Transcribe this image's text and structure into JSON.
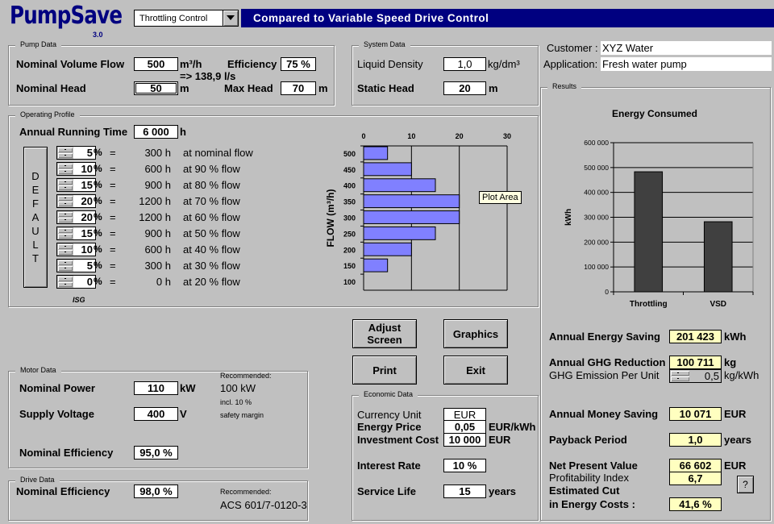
{
  "header": {
    "logo": "PumpSave",
    "version": "3.0",
    "control_select": "Throttling Control",
    "title": "Compared to Variable Speed Drive Control"
  },
  "pump_data": {
    "group_label": "Pump Data",
    "nominal_volume_flow_label": "Nominal Volume Flow",
    "nominal_volume_flow": "500",
    "nominal_volume_flow_unit": "m³/h",
    "flow_ls": "=> 138,9 l/s",
    "efficiency_label": "Efficiency",
    "efficiency": "75 %",
    "nominal_head_label": "Nominal Head",
    "nominal_head": "50",
    "nominal_head_unit": "m",
    "max_head_label": "Max Head",
    "max_head": "70",
    "max_head_unit": "m"
  },
  "system_data": {
    "group_label": "System Data",
    "liquid_density_label": "Liquid Density",
    "liquid_density": "1,0",
    "liquid_density_unit": "kg/dm³",
    "static_head_label": "Static Head",
    "static_head": "20",
    "static_head_unit": "m"
  },
  "customer": {
    "customer_label": "Customer :",
    "customer": "XYZ Water",
    "application_label": "Application:",
    "application": "Fresh water pump"
  },
  "operating_profile": {
    "group_label": "Operating Profile",
    "annual_running_time_label": "Annual Running Time",
    "annual_running_time": "6 000",
    "annual_running_time_unit": "h",
    "default_button": [
      "D",
      "E",
      "F",
      "A",
      "U",
      "L",
      "T"
    ],
    "logo_small": "ISG",
    "rows": [
      {
        "pct": "5",
        "hours": "300 h",
        "desc": "at nominal flow"
      },
      {
        "pct": "10",
        "hours": "600 h",
        "desc": "at 90 % flow"
      },
      {
        "pct": "15",
        "hours": "900 h",
        "desc": "at 80 % flow"
      },
      {
        "pct": "20",
        "hours": "1200 h",
        "desc": "at 70 % flow"
      },
      {
        "pct": "20",
        "hours": "1200 h",
        "desc": "at 60 % flow"
      },
      {
        "pct": "15",
        "hours": "900 h",
        "desc": "at 50 % flow"
      },
      {
        "pct": "10",
        "hours": "600 h",
        "desc": "at 40 % flow"
      },
      {
        "pct": "5",
        "hours": "300 h",
        "desc": "at 30 % flow"
      },
      {
        "pct": "0",
        "hours": "0 h",
        "desc": "at 20 % flow"
      }
    ],
    "pct_sign": "%",
    "equals": "="
  },
  "tooltip": "Plot Area",
  "buttons": {
    "adjust_screen": "Adjust Screen",
    "graphics": "Graphics",
    "print": "Print",
    "exit": "Exit",
    "help": "?"
  },
  "motor_data": {
    "group_label": "Motor Data",
    "nominal_power_label": "Nominal Power",
    "nominal_power": "110",
    "nominal_power_unit": "kW",
    "supply_voltage_label": "Supply Voltage",
    "supply_voltage": "400",
    "supply_voltage_unit": "V",
    "nominal_efficiency_label": "Nominal Efficiency",
    "nominal_efficiency": "95,0 %",
    "recommended_label": "Recommended:",
    "recommended_value": "100 kW",
    "recommended_note1": "incl. 10 %",
    "recommended_note2": "safety margin"
  },
  "drive_data": {
    "group_label": "Drive Data",
    "nominal_efficiency_label": "Nominal Efficiency",
    "nominal_efficiency": "98,0 %",
    "recommended_label": "Recommended:",
    "recommended_value": "ACS 601/7-0120-3"
  },
  "economic_data": {
    "group_label": "Economic Data",
    "currency_unit_label": "Currency Unit",
    "currency_unit": "EUR",
    "energy_price_label": "Energy Price",
    "energy_price": "0,05",
    "energy_price_unit": "EUR/kWh",
    "investment_cost_label": "Investment Cost",
    "investment_cost": "10 000",
    "investment_cost_unit": "EUR",
    "interest_rate_label": "Interest Rate",
    "interest_rate": "10 %",
    "service_life_label": "Service Life",
    "service_life": "15",
    "service_life_unit": "years"
  },
  "results": {
    "group_label": "Results",
    "annual_energy_saving_label": "Annual Energy Saving",
    "annual_energy_saving": "201 423",
    "annual_energy_saving_unit": "kWh",
    "annual_ghg_reduction_label": "Annual GHG Reduction",
    "annual_ghg_reduction": "100 711",
    "annual_ghg_reduction_unit": "kg",
    "ghg_emission_label": "GHG Emission Per Unit",
    "ghg_emission": "0,5",
    "ghg_emission_unit": "kg/kWh",
    "annual_money_saving_label": "Annual Money Saving",
    "annual_money_saving": "10 071",
    "annual_money_saving_unit": "EUR",
    "payback_label": "Payback Period",
    "payback": "1,0",
    "payback_unit": "years",
    "npv_label": "Net Present Value",
    "npv": "66 602",
    "npv_unit": "EUR",
    "profitability_label": "Profitability Index",
    "profitability": "6,7",
    "cut_label1": "Estimated Cut",
    "cut_label2": "in Energy Costs :",
    "cut": "41,6 %"
  },
  "chart_data": [
    {
      "type": "bar",
      "orientation": "horizontal",
      "title": "",
      "ylabel": "FLOW (m³/h)",
      "xlabel": "",
      "categories": [
        "500",
        "450",
        "400",
        "350",
        "300",
        "250",
        "200",
        "150",
        "100"
      ],
      "values": [
        5,
        10,
        15,
        20,
        20,
        15,
        10,
        5,
        0
      ],
      "xlim": [
        0,
        30
      ],
      "xticks": [
        "0",
        "10",
        "20",
        "30"
      ],
      "grid": true,
      "color": "#8080ff"
    },
    {
      "type": "bar",
      "title": "Energy Consumed",
      "ylabel": "kWh",
      "xlabel": "",
      "categories": [
        "Throttling",
        "VSD"
      ],
      "values": [
        483000,
        282000
      ],
      "ylim": [
        0,
        600000
      ],
      "yticks": [
        "0",
        "100 000",
        "200 000",
        "300 000",
        "400 000",
        "500 000",
        "600 000"
      ],
      "grid": true,
      "color": "#404040"
    }
  ]
}
